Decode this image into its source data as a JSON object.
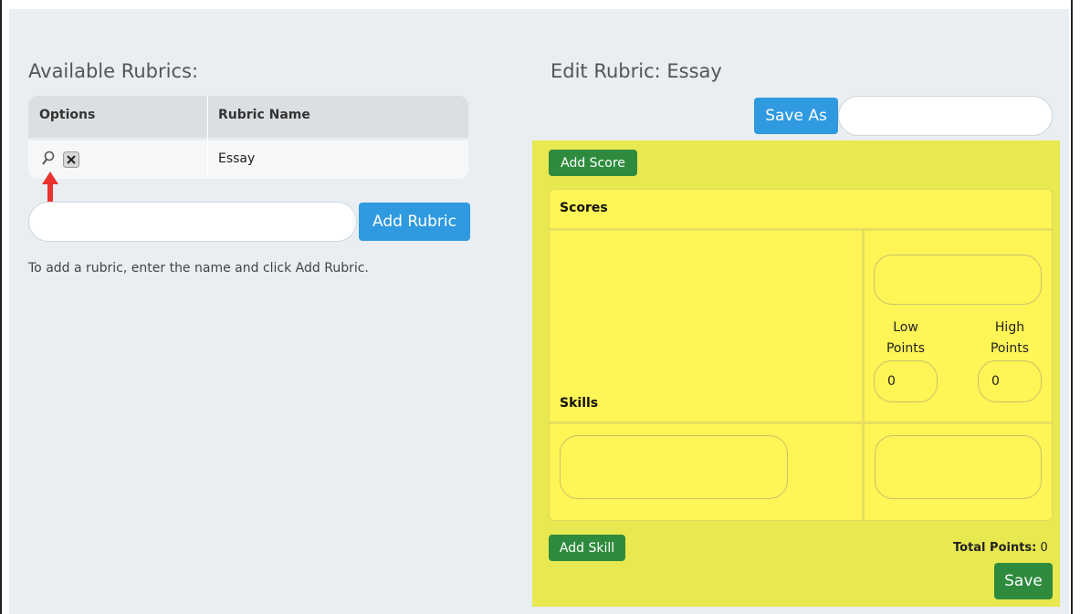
{
  "left": {
    "heading": "Available Rubrics:",
    "table": {
      "headers": [
        "Options",
        "Rubric Name"
      ],
      "rows": [
        {
          "name": "Essay",
          "icons": [
            "magnifier-icon",
            "delete-icon"
          ]
        }
      ]
    },
    "add_input": {
      "value": "",
      "placeholder": ""
    },
    "add_button": "Add Rubric",
    "help_text": "To add a rubric, enter the name and click Add Rubric."
  },
  "right": {
    "heading": "Edit Rubric: Essay",
    "save_as_button": "Save As",
    "save_as_input": {
      "value": "",
      "placeholder": ""
    },
    "add_score_button": "Add Score",
    "scores_label": "Scores",
    "skills_label": "Skills",
    "low_points_label": "Low Points",
    "high_points_label": "High Points",
    "low_points_value": "0",
    "high_points_value": "0",
    "add_skill_button": "Add Skill",
    "total_points_label": "Total Points:",
    "total_points_value": "0",
    "save_button": "Save"
  },
  "colors": {
    "panel_bg": "#e8eef2",
    "blue": "#2f9ae0",
    "green": "#2e8b3e",
    "editor_bg": "#e8e850",
    "grid_bg": "#fff556",
    "arrow": "#e8332e"
  }
}
